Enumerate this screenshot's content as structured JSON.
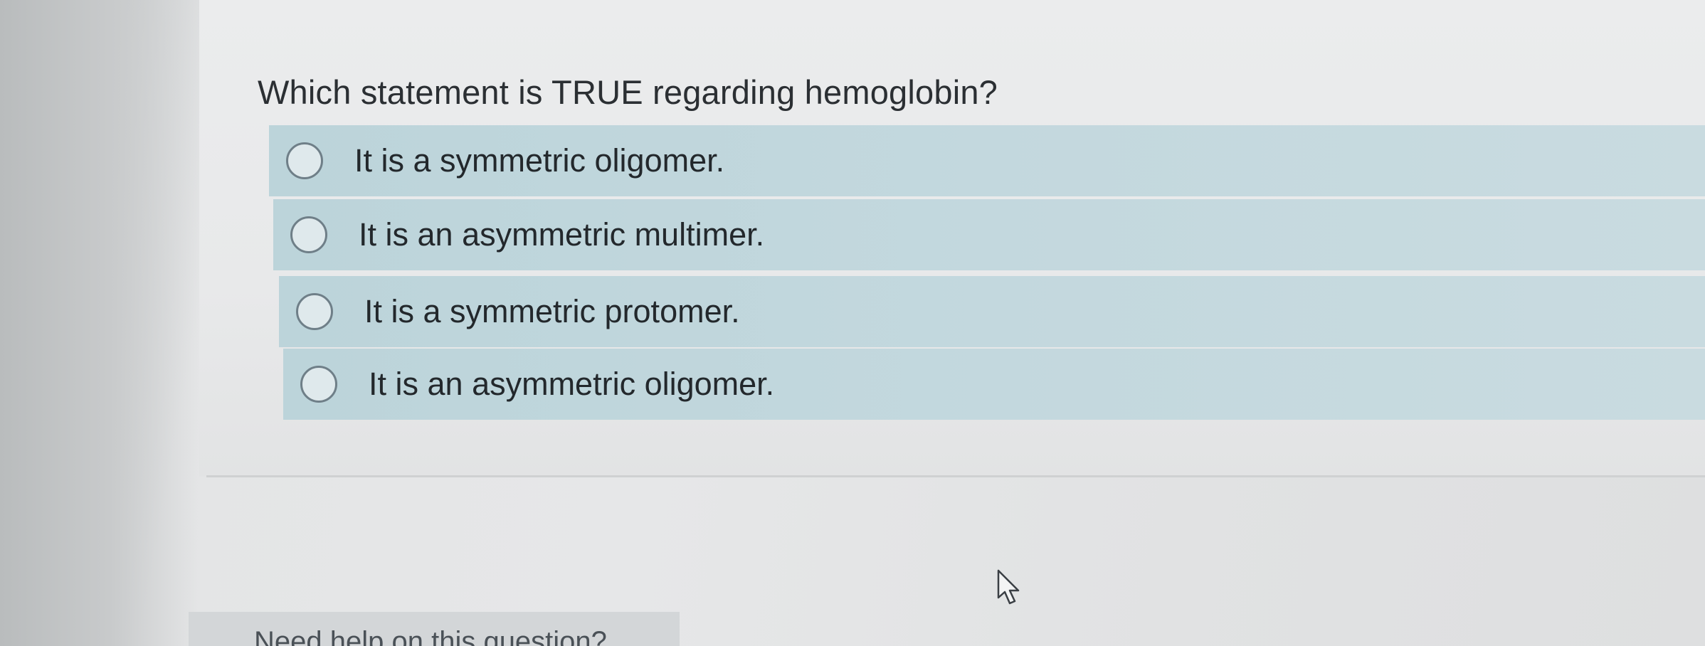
{
  "question": {
    "text": "Which statement is TRUE regarding hemoglobin?"
  },
  "options": [
    {
      "label": "It is a symmetric oligomer.",
      "selected": false
    },
    {
      "label": "It is an asymmetric multimer.",
      "selected": false
    },
    {
      "label": "It is a symmetric protomer.",
      "selected": false
    },
    {
      "label": "It is an asymmetric oligomer.",
      "selected": false
    }
  ],
  "help": {
    "label": "Need help on this question?"
  },
  "colors": {
    "option_background": "#c3d8de",
    "radio_border": "#6f7f88",
    "text": "#2b2f33"
  },
  "icons": {
    "cursor": "mouse-pointer-icon",
    "radio": "radio-circle-icon"
  }
}
